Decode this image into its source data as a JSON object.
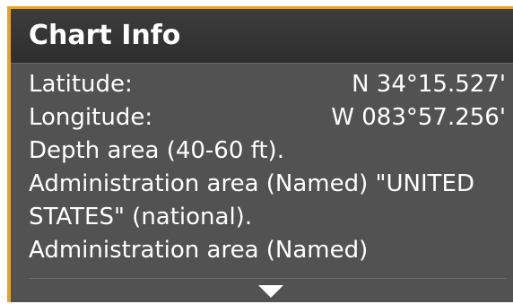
{
  "panel": {
    "title": "Chart Info",
    "latitude_label": "Latitude:",
    "latitude_value": "N 34°15.527'",
    "longitude_label": "Longitude:",
    "longitude_value": "W 083°57.256'",
    "info_lines": [
      "Depth area (40-60 ft).",
      "Administration area (Named) \"UNITED",
      "STATES\" (national).",
      "Administration area (Named)"
    ],
    "scroll_icon": "triangle-down-icon"
  },
  "colors": {
    "accent": "#e7a323",
    "panel_bg": "#525252",
    "header_bg": "#333333",
    "text": "#ffffff"
  }
}
